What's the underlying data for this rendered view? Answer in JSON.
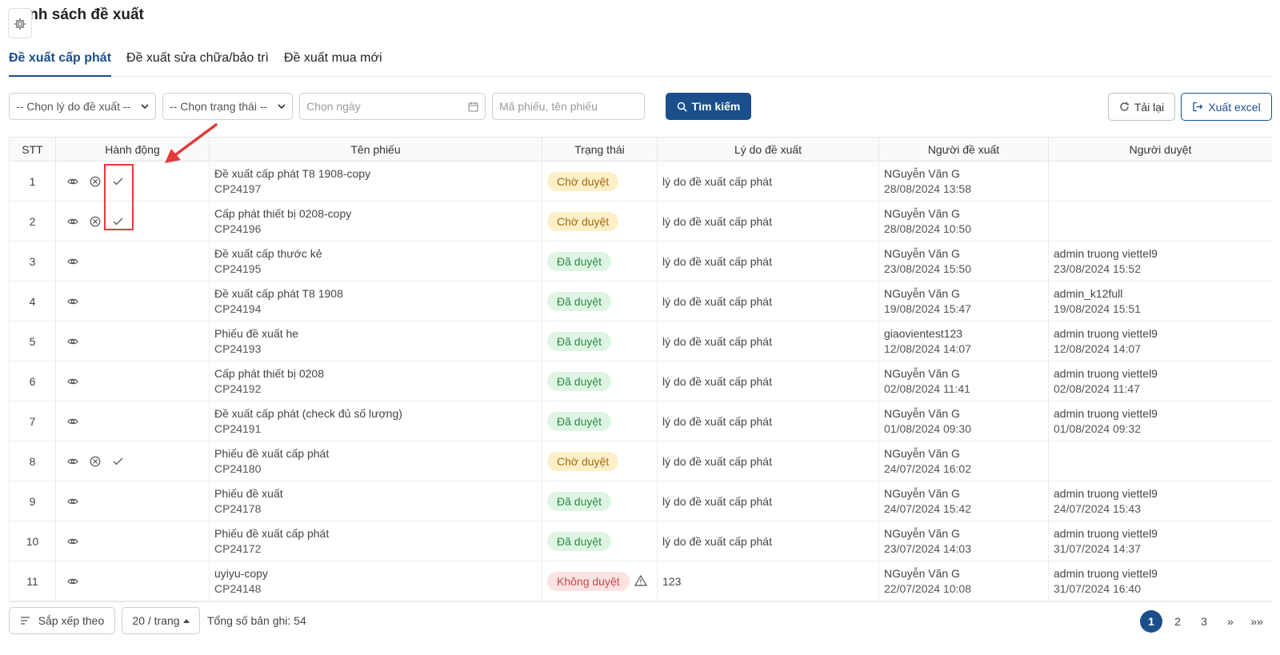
{
  "page": {
    "title": "Danh sách đề xuất"
  },
  "tabs": [
    {
      "label": "Đề xuất cấp phát",
      "active": true
    },
    {
      "label": "Đề xuất sửa chữa/bảo trì",
      "active": false
    },
    {
      "label": "Đề xuất mua mới",
      "active": false
    }
  ],
  "filters": {
    "reason_select": "-- Chọn lý do đề xuất --",
    "status_select": "-- Chọn trạng thái --",
    "date_placeholder": "Chọn ngày",
    "keyword_placeholder": "Mã phiếu, tên phiếu",
    "search_label": "Tìm kiếm",
    "reload_label": "Tải lại",
    "export_label": "Xuất excel"
  },
  "table": {
    "columns": [
      "STT",
      "Hành động",
      "Tên phiếu",
      "Trạng thái",
      "Lý do đề xuất",
      "Người đề xuất",
      "Người duyệt"
    ],
    "rows": [
      {
        "stt": "1",
        "actions": [
          "view",
          "reject",
          "approve"
        ],
        "name": "Đề xuất cấp phát T8 1908-copy",
        "code": "CP24197",
        "status": "Chờ duyệt",
        "status_type": "pending",
        "reason": "lý do đề xuất cấp phát",
        "proposer": "NGuyễn Văn G",
        "proposed_at": "28/08/2024 13:58",
        "approver": "",
        "approved_at": ""
      },
      {
        "stt": "2",
        "actions": [
          "view",
          "reject",
          "approve"
        ],
        "name": "Cấp phát thiết bị 0208-copy",
        "code": "CP24196",
        "status": "Chờ duyệt",
        "status_type": "pending",
        "reason": "lý do đề xuất cấp phát",
        "proposer": "NGuyễn Văn G",
        "proposed_at": "28/08/2024 10:50",
        "approver": "",
        "approved_at": ""
      },
      {
        "stt": "3",
        "actions": [
          "view"
        ],
        "name": "Đề xuất cấp thước kẻ",
        "code": "CP24195",
        "status": "Đã duyệt",
        "status_type": "approved",
        "reason": "lý do đề xuất cấp phát",
        "proposer": "NGuyễn Văn G",
        "proposed_at": "23/08/2024 15:50",
        "approver": "admin truong viettel9",
        "approved_at": "23/08/2024 15:52"
      },
      {
        "stt": "4",
        "actions": [
          "view"
        ],
        "name": "Đề xuất cấp phát T8 1908",
        "code": "CP24194",
        "status": "Đã duyệt",
        "status_type": "approved",
        "reason": "lý do đề xuất cấp phát",
        "proposer": "NGuyễn Văn G",
        "proposed_at": "19/08/2024 15:47",
        "approver": "admin_k12full",
        "approved_at": "19/08/2024 15:51"
      },
      {
        "stt": "5",
        "actions": [
          "view"
        ],
        "name": "Phiếu đề xuất he",
        "code": "CP24193",
        "status": "Đã duyệt",
        "status_type": "approved",
        "reason": "lý do đề xuất cấp phát",
        "proposer": "giaovientest123",
        "proposed_at": "12/08/2024 14:07",
        "approver": "admin truong viettel9",
        "approved_at": "12/08/2024 14:07"
      },
      {
        "stt": "6",
        "actions": [
          "view"
        ],
        "name": "Cấp phát thiết bị 0208",
        "code": "CP24192",
        "status": "Đã duyệt",
        "status_type": "approved",
        "reason": "lý do đề xuất cấp phát",
        "proposer": "NGuyễn Văn G",
        "proposed_at": "02/08/2024 11:41",
        "approver": "admin truong viettel9",
        "approved_at": "02/08/2024 11:47"
      },
      {
        "stt": "7",
        "actions": [
          "view"
        ],
        "name": "Đề xuất cấp phát (check đủ số lượng)",
        "code": "CP24191",
        "status": "Đã duyệt",
        "status_type": "approved",
        "reason": "lý do đề xuất cấp phát",
        "proposer": "NGuyễn Văn G",
        "proposed_at": "01/08/2024 09:30",
        "approver": "admin truong viettel9",
        "approved_at": "01/08/2024 09:32"
      },
      {
        "stt": "8",
        "actions": [
          "view",
          "reject",
          "approve"
        ],
        "name": "Phiếu đề xuất cấp phát",
        "code": "CP24180",
        "status": "Chờ duyệt",
        "status_type": "pending",
        "reason": "lý do đề xuất cấp phát",
        "proposer": "NGuyễn Văn G",
        "proposed_at": "24/07/2024 16:02",
        "approver": "",
        "approved_at": ""
      },
      {
        "stt": "9",
        "actions": [
          "view"
        ],
        "name": "Phiếu đề xuất",
        "code": "CP24178",
        "status": "Đã duyệt",
        "status_type": "approved",
        "reason": "lý do đề xuất cấp phát",
        "proposer": "NGuyễn Văn G",
        "proposed_at": "24/07/2024 15:42",
        "approver": "admin truong viettel9",
        "approved_at": "24/07/2024 15:43"
      },
      {
        "stt": "10",
        "actions": [
          "view"
        ],
        "name": "Phiếu đề xuất cấp phát",
        "code": "CP24172",
        "status": "Đã duyệt",
        "status_type": "approved",
        "reason": "lý do đề xuất cấp phát",
        "proposer": "NGuyễn Văn G",
        "proposed_at": "23/07/2024 14:03",
        "approver": "admin truong viettel9",
        "approved_at": "31/07/2024 14:37"
      },
      {
        "stt": "11",
        "actions": [
          "view"
        ],
        "name": "uyiyu-copy",
        "code": "CP24148",
        "status": "Không duyệt",
        "status_type": "rejected",
        "warning": true,
        "reason": "123",
        "proposer": "NGuyễn Văn G",
        "proposed_at": "22/07/2024 10:08",
        "approver": "admin truong viettel9",
        "approved_at": "31/07/2024 16:40"
      }
    ]
  },
  "footer": {
    "sort_label": "Sắp xếp theo",
    "page_size": "20 / trang",
    "total_label": "Tổng số bản ghi: 54"
  },
  "pagination": {
    "pages": [
      "1",
      "2",
      "3"
    ],
    "current": "1",
    "next": "»",
    "last": "»»"
  },
  "colors": {
    "primary": "#1b4f8c",
    "annotation": "#e23b3b",
    "pending_bg": "#fdf0c9",
    "approved_bg": "#dff5e4",
    "rejected_bg": "#fde2e2"
  }
}
